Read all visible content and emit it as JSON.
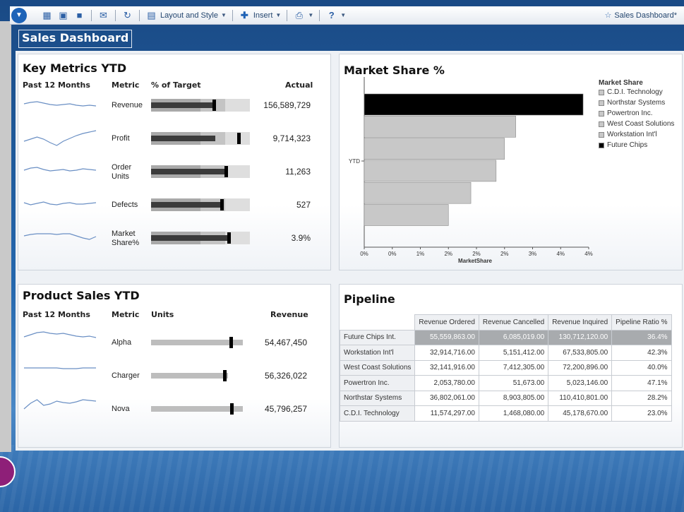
{
  "toolbar": {
    "layout_label": "Layout and Style",
    "insert_label": "Insert",
    "doc_title": "Sales Dashboard*"
  },
  "dashboard": {
    "title": "Sales Dashboard"
  },
  "key_metrics": {
    "title": "Key Metrics YTD",
    "headers": {
      "past": "Past 12 Months",
      "metric": "Metric",
      "target": "% of Target",
      "actual": "Actual"
    },
    "rows": [
      {
        "metric": "Revenue",
        "actual": "156,589,729",
        "bar": 0.79,
        "marker": 0.62,
        "spark": [
          14,
          12,
          11,
          13,
          15,
          16,
          15,
          14,
          16,
          17,
          16,
          17
        ]
      },
      {
        "metric": "Profit",
        "actual": "9,714,323",
        "bar": 0.81,
        "marker": 0.87,
        "spark": [
          20,
          17,
          14,
          17,
          22,
          26,
          20,
          16,
          12,
          9,
          7,
          5
        ]
      },
      {
        "metric": "Order\nUnits",
        "actual": "11,263",
        "bar": 0.94,
        "marker": 0.74,
        "spark": [
          14,
          11,
          10,
          13,
          15,
          14,
          13,
          15,
          14,
          12,
          13,
          14
        ]
      },
      {
        "metric": "Defects",
        "actual": "527",
        "bar": 0.89,
        "marker": 0.7,
        "spark": [
          13,
          16,
          14,
          12,
          15,
          16,
          14,
          13,
          15,
          15,
          14,
          13
        ]
      },
      {
        "metric": "Market\nShare%",
        "actual": "3.9%",
        "bar": 0.98,
        "marker": 0.77,
        "spark": [
          13,
          11,
          10,
          10,
          10,
          11,
          10,
          10,
          13,
          16,
          18,
          14
        ]
      }
    ]
  },
  "product_sales": {
    "title": "Product Sales YTD",
    "headers": {
      "past": "Past 12 Months",
      "metric": "Metric",
      "units": "Units",
      "revenue": "Revenue"
    },
    "rows": [
      {
        "metric": "Alpha",
        "revenue": "54,467,450",
        "bar": 1.0,
        "marker": 0.79,
        "spark": [
          16,
          13,
          10,
          9,
          11,
          12,
          11,
          13,
          15,
          16,
          15,
          17
        ]
      },
      {
        "metric": "Charger",
        "revenue": "56,326,022",
        "bar": 0.92,
        "marker": 0.73,
        "spark": [
          13,
          13,
          13,
          13,
          13,
          13,
          14,
          14,
          14,
          13,
          13,
          13
        ]
      },
      {
        "metric": "Nova",
        "revenue": "45,796,257",
        "bar": 1.0,
        "marker": 0.8,
        "spark": [
          24,
          16,
          11,
          19,
          17,
          13,
          15,
          16,
          14,
          11,
          12,
          13
        ]
      }
    ]
  },
  "market_share": {
    "title": "Market Share %",
    "legend_title": "Market Share",
    "legend": [
      {
        "name": "C.D.I. Technology",
        "color": "#c8c8c8"
      },
      {
        "name": "Northstar Systems",
        "color": "#c8c8c8"
      },
      {
        "name": "Powertron Inc.",
        "color": "#c8c8c8"
      },
      {
        "name": "West Coast Solutions",
        "color": "#c8c8c8"
      },
      {
        "name": "Workstation Int'l",
        "color": "#c8c8c8"
      },
      {
        "name": "Future Chips",
        "color": "#000000"
      }
    ],
    "y_label": "YTD",
    "x_label": "MarketShare",
    "x_ticks": [
      "0%",
      "0%",
      "1%",
      "2%",
      "2%",
      "2%",
      "3%",
      "4%",
      "4%"
    ]
  },
  "chart_data": {
    "type": "bar",
    "orientation": "horizontal",
    "title": "Market Share %",
    "categories": [
      "YTD"
    ],
    "series": [
      {
        "name": "Future Chips",
        "values": [
          3.9
        ],
        "color": "#000000"
      },
      {
        "name": "Workstation Int'l",
        "values": [
          2.7
        ],
        "color": "#c8c8c8"
      },
      {
        "name": "West Coast Solutions",
        "values": [
          2.5
        ],
        "color": "#c8c8c8"
      },
      {
        "name": "Powertron Inc.",
        "values": [
          2.35
        ],
        "color": "#c8c8c8"
      },
      {
        "name": "Northstar Systems",
        "values": [
          1.9
        ],
        "color": "#c8c8c8"
      },
      {
        "name": "C.D.I. Technology",
        "values": [
          1.5
        ],
        "color": "#c8c8c8"
      }
    ],
    "xlabel": "MarketShare",
    "ylabel": "",
    "xlim": [
      0,
      4
    ],
    "legend": "top-right"
  },
  "pipeline": {
    "title": "Pipeline",
    "columns": [
      "Revenue Ordered",
      "Revenue Cancelled",
      "Revenue Inquired",
      "Pipeline Ratio %"
    ],
    "rows": [
      {
        "label": "Future Chips Int.",
        "cells": [
          "55,559,863.00",
          "6,085,019.00",
          "130,712,120.00",
          "36.4%"
        ]
      },
      {
        "label": "Workstation Int'l",
        "cells": [
          "32,914,716.00",
          "5,151,412.00",
          "67,533,805.00",
          "42.3%"
        ]
      },
      {
        "label": "West Coast Solutions",
        "cells": [
          "32,141,916.00",
          "7,412,305.00",
          "72,200,896.00",
          "40.0%"
        ]
      },
      {
        "label": "Powertron Inc.",
        "cells": [
          "2,053,780.00",
          "51,673.00",
          "5,023,146.00",
          "47.1%"
        ]
      },
      {
        "label": "Northstar Systems",
        "cells": [
          "36,802,061.00",
          "8,903,805.00",
          "110,410,801.00",
          "28.2%"
        ]
      },
      {
        "label": "C.D.I. Technology",
        "cells": [
          "11,574,297.00",
          "1,468,080.00",
          "45,178,670.00",
          "23.0%"
        ]
      }
    ]
  }
}
